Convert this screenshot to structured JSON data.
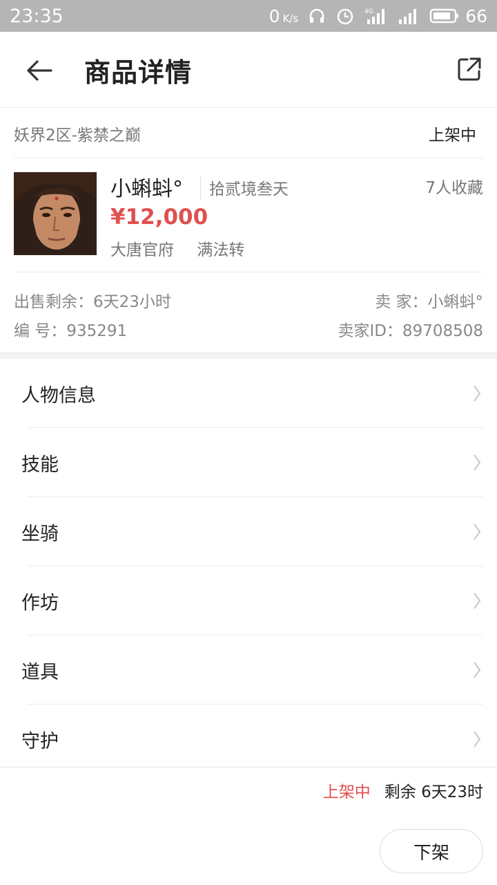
{
  "status_bar": {
    "time": "23:35",
    "net_speed": "0",
    "net_speed_unit": "K/s",
    "battery": "66",
    "icons": [
      "headset-icon",
      "alarm-icon",
      "signal-4g-icon",
      "signal-icon",
      "battery-icon"
    ]
  },
  "header": {
    "title": "商品详情",
    "back_icon": "arrow-left-icon",
    "share_icon": "share-icon"
  },
  "listing": {
    "server": "妖界2区-紫禁之巅",
    "status": "上架中"
  },
  "product": {
    "name": "小蝌蚪°",
    "level": "拾贰境叁天",
    "favorites": "7人收藏",
    "price": "¥12,000",
    "sect": "大唐官府",
    "rebirth": "满法转"
  },
  "meta": {
    "time_left": "出售剩余：6天23小时",
    "seller": "卖  家：小蝌蚪°",
    "serial": "编  号：935291",
    "seller_id": "卖家ID：89708508"
  },
  "menu": [
    {
      "label": "人物信息"
    },
    {
      "label": "技能"
    },
    {
      "label": "坐骑"
    },
    {
      "label": "作坊"
    },
    {
      "label": "道具"
    },
    {
      "label": "守护"
    }
  ],
  "footer": {
    "status": "上架中",
    "remaining": "剩余 6天23时",
    "delist_label": "下架"
  },
  "colors": {
    "accent_red": "#e05050",
    "status_bar": "#b5b5b5"
  }
}
